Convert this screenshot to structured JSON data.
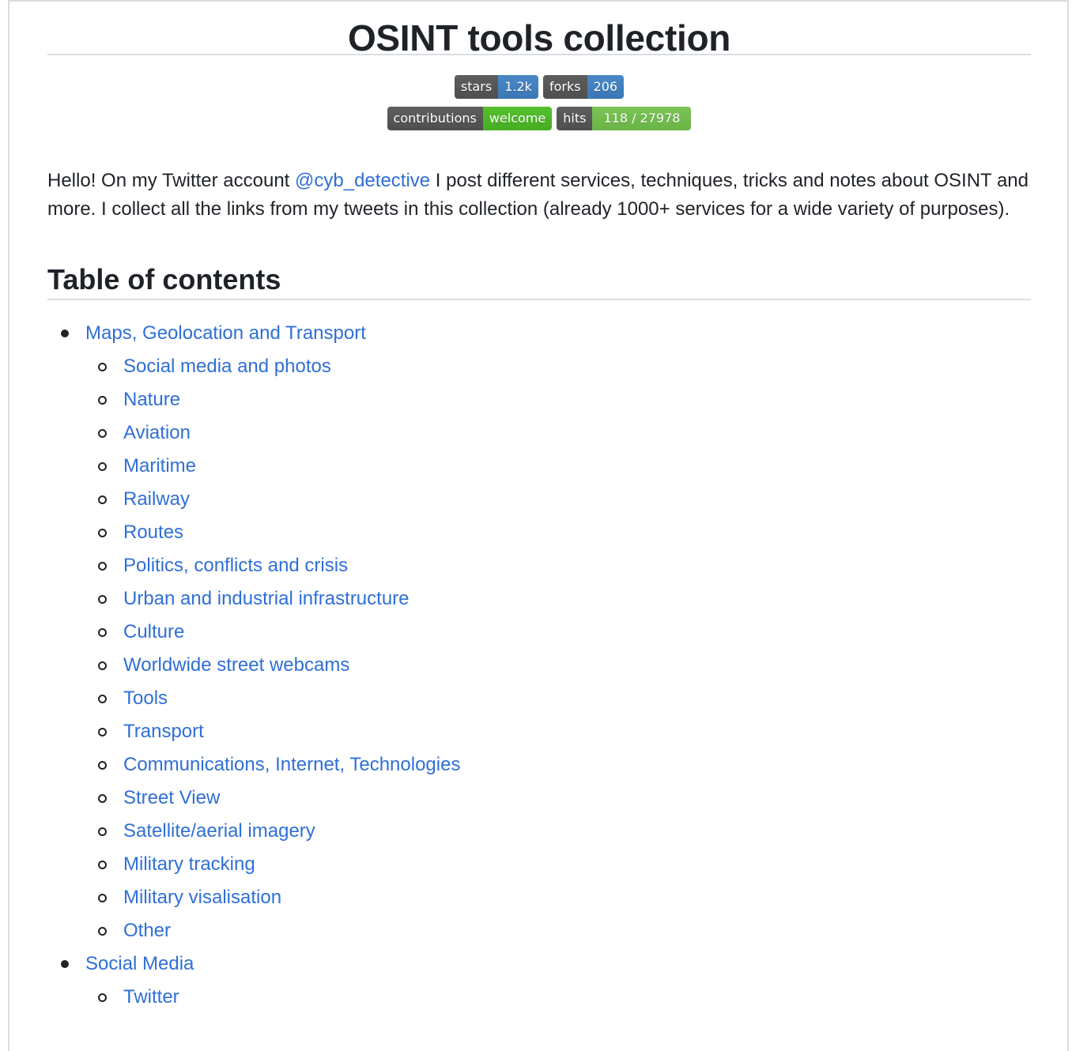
{
  "title": "OSINT tools collection",
  "badges": {
    "stars": {
      "label": "stars",
      "value": "1.2k"
    },
    "forks": {
      "label": "forks",
      "value": "206"
    },
    "contributions": {
      "label": "contributions",
      "value": "welcome"
    },
    "hits": {
      "label": "hits",
      "value": "118 / 27978"
    }
  },
  "intro": {
    "before": "Hello! On my Twitter account ",
    "link": "@cyb_detective",
    "after": " I post different services, techniques, tricks and notes about OSINT and more. I collect all the links from my tweets in this collection (already 1000+ services for a wide variety of purposes)."
  },
  "toc": {
    "heading": "Table of contents",
    "section1": {
      "label": "Maps, Geolocation and Transport",
      "items": [
        "Social media and photos",
        "Nature",
        "Aviation",
        "Maritime",
        "Railway",
        "Routes",
        "Politics, conflicts and crisis",
        "Urban and industrial infrastructure",
        "Culture",
        "Worldwide street webcams",
        "Tools",
        "Transport",
        "Communications, Internet, Technologies",
        "Street View",
        "Satellite/aerial imagery",
        "Military tracking",
        "Military visalisation",
        "Other"
      ]
    },
    "section2": {
      "label": "Social Media",
      "items": [
        "Twitter"
      ]
    }
  }
}
